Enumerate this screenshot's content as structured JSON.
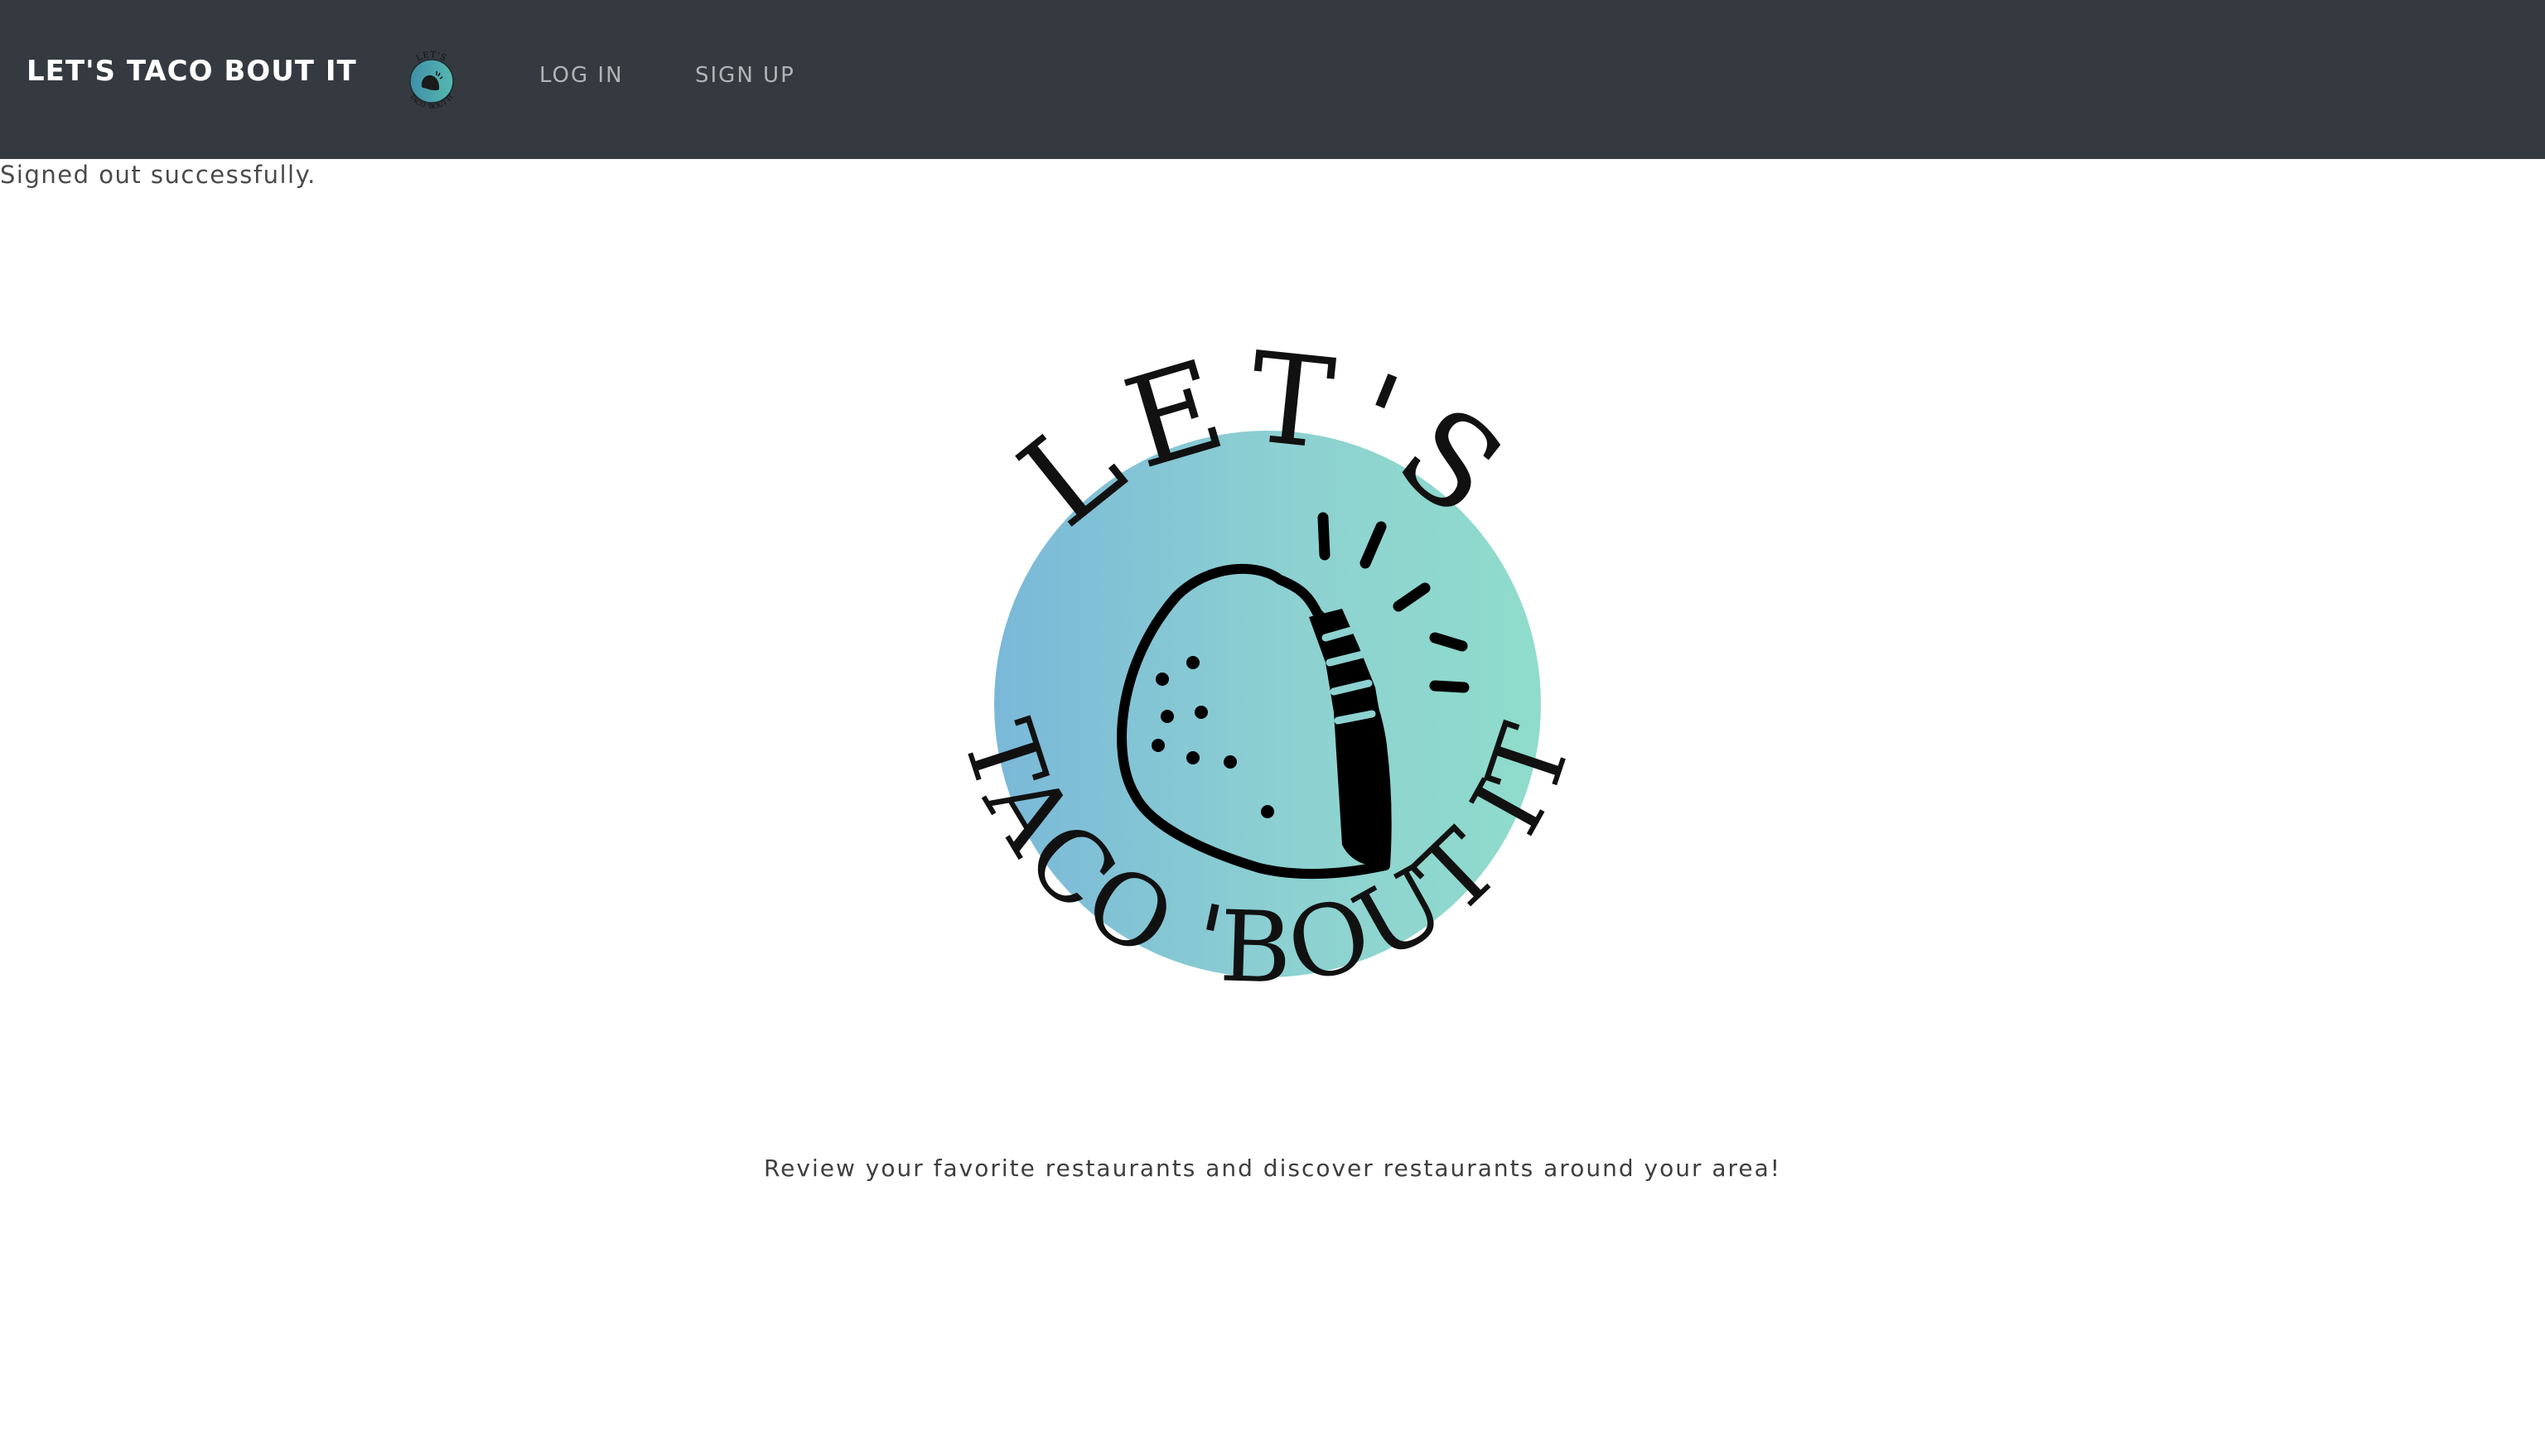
{
  "navbar": {
    "brand": "LET'S TACO BOUT IT",
    "links": [
      {
        "label": "LOG IN"
      },
      {
        "label": "SIGN UP"
      }
    ],
    "background_color": "#343a40"
  },
  "flash": {
    "message": "Signed out successfully."
  },
  "hero": {
    "logo_top_text": "LET'S",
    "logo_bottom_text": "TACO 'BOUT IT",
    "gradient_start": "#7ab8d8",
    "gradient_end": "#8fdccb",
    "tagline": "Review your favorite restaurants and discover restaurants around your area!"
  }
}
